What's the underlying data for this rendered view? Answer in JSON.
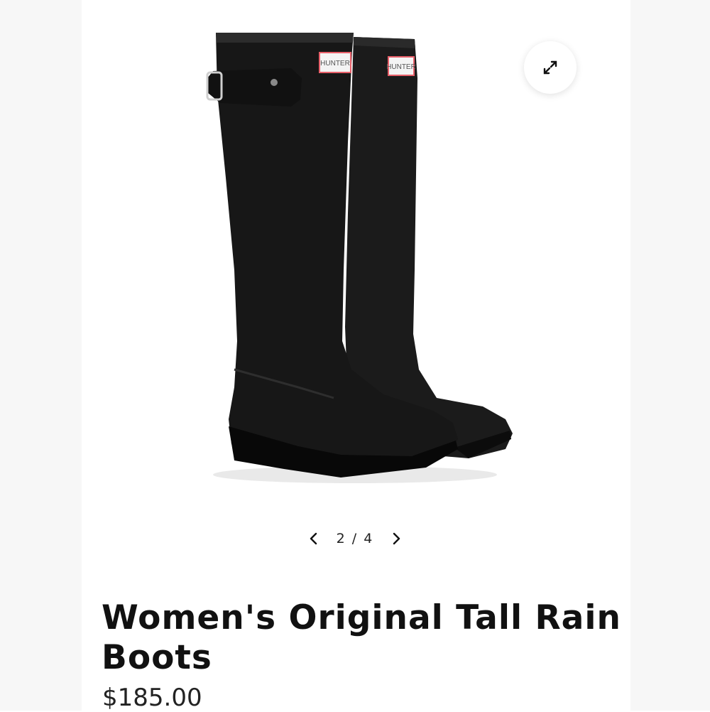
{
  "product": {
    "title": "Women's Original Tall Rain Boots",
    "price": "$185.00",
    "brand_tag": "HUNTER",
    "image_alt": "Black tall rain boots"
  },
  "gallery": {
    "current": "2",
    "separator": "/",
    "total": "4",
    "prev_icon": "chevron-left-icon",
    "next_icon": "chevron-right-icon",
    "expand_icon": "expand-arrows-icon"
  },
  "colors": {
    "boot": "#141414",
    "label_border": "#e8606a",
    "text": "#111111"
  }
}
